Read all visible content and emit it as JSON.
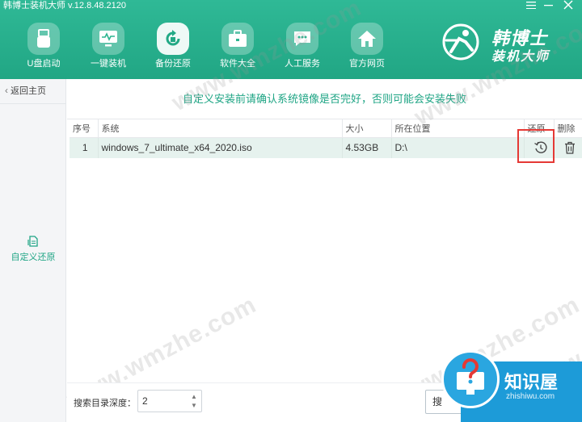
{
  "window": {
    "title": "韩博士装机大师 v.12.8.48.2120",
    "menu_icon": "hamburger-icon",
    "minimize_icon": "minimize-icon",
    "close_icon": "close-icon"
  },
  "nav": [
    {
      "label": "U盘启动",
      "icon": "usb-drive-icon",
      "active": false
    },
    {
      "label": "一键装机",
      "icon": "monitor-install-icon",
      "active": false
    },
    {
      "label": "备份还原",
      "icon": "backup-restore-icon",
      "active": true
    },
    {
      "label": "软件大全",
      "icon": "briefcase-icon",
      "active": false
    },
    {
      "label": "人工服务",
      "icon": "chat-service-icon",
      "active": false
    },
    {
      "label": "官方网页",
      "icon": "home-icon",
      "active": false
    }
  ],
  "logo": {
    "line1": "韩博士",
    "line2": "装机大师"
  },
  "sidebar": {
    "back_label": "返回主页",
    "items": [
      {
        "label": "自定义还原",
        "icon": "document-restore-icon",
        "active": true
      }
    ]
  },
  "notice": "自定义安装前请确认系统镜像是否完好，否则可能会安装失败",
  "table": {
    "headers": [
      "序号",
      "系统",
      "大小",
      "所在位置",
      "还原",
      "删除"
    ],
    "rows": [
      {
        "index": "1",
        "system": "windows_7_ultimate_x64_2020.iso",
        "size": "4.53GB",
        "location": "D:\\",
        "restore_icon": "restore-clock-icon",
        "delete_icon": "trash-icon"
      }
    ]
  },
  "bottom": {
    "depth_label": "搜索目录深度：",
    "depth_value": "2",
    "search_button": "搜"
  },
  "watermarks": [
    "www.wmzhe.com",
    "www.wmzhe.com",
    "www.wmzhe.com",
    "www.wmzhe.com",
    "www.wmzhe.com"
  ],
  "badge": {
    "name": "知识屋",
    "url": "zhishiwu.com"
  },
  "colors": {
    "accent": "#21a684",
    "highlight_box": "#e53935",
    "row_bg": "#e6f2ee"
  }
}
